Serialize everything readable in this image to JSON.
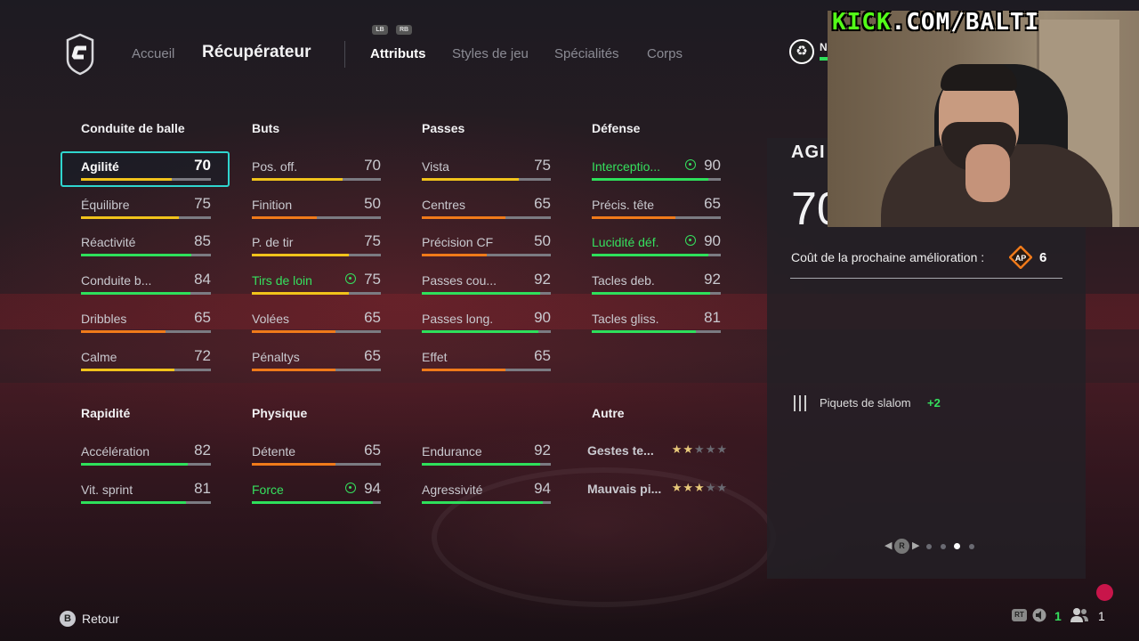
{
  "nav": {
    "home": "Accueil",
    "title": "Récupérateur",
    "bumper_left": "LB",
    "bumper_right": "RB",
    "tabs": [
      "Attributs",
      "Styles de jeu",
      "Spécialités",
      "Corps"
    ],
    "slot_label": "N"
  },
  "colors": {
    "selected_border": "#2fd6cf",
    "boost_green": "#35e05e",
    "bar_green": "#2ee05b",
    "bar_yellow": "#f1c31b",
    "bar_orange": "#f07a1a",
    "bar_track": "#7b7b82"
  },
  "sections": {
    "dribbling": "Conduite de balle",
    "shooting": "Buts",
    "passing": "Passes",
    "defending": "Défense",
    "pace": "Rapidité",
    "physical": "Physique",
    "other": "Autre"
  },
  "stats": {
    "dribbling": [
      {
        "label": "Agilité",
        "value": "70"
      },
      {
        "label": "Équilibre",
        "value": "75"
      },
      {
        "label": "Réactivité",
        "value": "85"
      },
      {
        "label": "Conduite b...",
        "value": "84"
      },
      {
        "label": "Dribbles",
        "value": "65"
      },
      {
        "label": "Calme",
        "value": "72"
      }
    ],
    "shooting": [
      {
        "label": "Pos. off.",
        "value": "70"
      },
      {
        "label": "Finition",
        "value": "50"
      },
      {
        "label": "P. de tir",
        "value": "75"
      },
      {
        "label": "Tirs de loin",
        "value": "75"
      },
      {
        "label": "Volées",
        "value": "65"
      },
      {
        "label": "Pénaltys",
        "value": "65"
      }
    ],
    "passing": [
      {
        "label": "Vista",
        "value": "75"
      },
      {
        "label": "Centres",
        "value": "65"
      },
      {
        "label": "Précision CF",
        "value": "50"
      },
      {
        "label": "Passes cou...",
        "value": "92"
      },
      {
        "label": "Passes long.",
        "value": "90"
      },
      {
        "label": "Effet",
        "value": "65"
      }
    ],
    "defending": [
      {
        "label": "Interceptio...",
        "value": "90"
      },
      {
        "label": "Précis. tête",
        "value": "65"
      },
      {
        "label": "Lucidité déf.",
        "value": "90"
      },
      {
        "label": "Tacles deb.",
        "value": "92"
      },
      {
        "label": "Tacles gliss.",
        "value": "81"
      }
    ],
    "pace": [
      {
        "label": "Accélération",
        "value": "82"
      },
      {
        "label": "Vit. sprint",
        "value": "81"
      }
    ],
    "physical": [
      {
        "label": "Détente",
        "value": "65"
      },
      {
        "label": "Force",
        "value": "94"
      },
      {
        "label": "Endurance",
        "value": "92"
      },
      {
        "label": "Agressivité",
        "value": "94"
      }
    ],
    "other": [
      {
        "label": "Gestes te...",
        "stars": 2
      },
      {
        "label": "Mauvais pi...",
        "stars": 3
      }
    ]
  },
  "panel": {
    "title": "AGI",
    "value": "70",
    "cost_label": "Coût de la prochaine amélioration :",
    "ap_badge": "AP",
    "cost_value": "6",
    "bonus_label": "Piquets de slalom",
    "bonus_value": "+2",
    "pager_button": "R",
    "pager_active": 3,
    "pager_count": 4
  },
  "overlay": {
    "kick_brand": "KICK",
    "kick_path": ".COM/BALTI"
  },
  "footer": {
    "back_button": "B",
    "back_label": "Retour",
    "rt_label": "RT",
    "voice_count": "1",
    "party_count": "1"
  }
}
